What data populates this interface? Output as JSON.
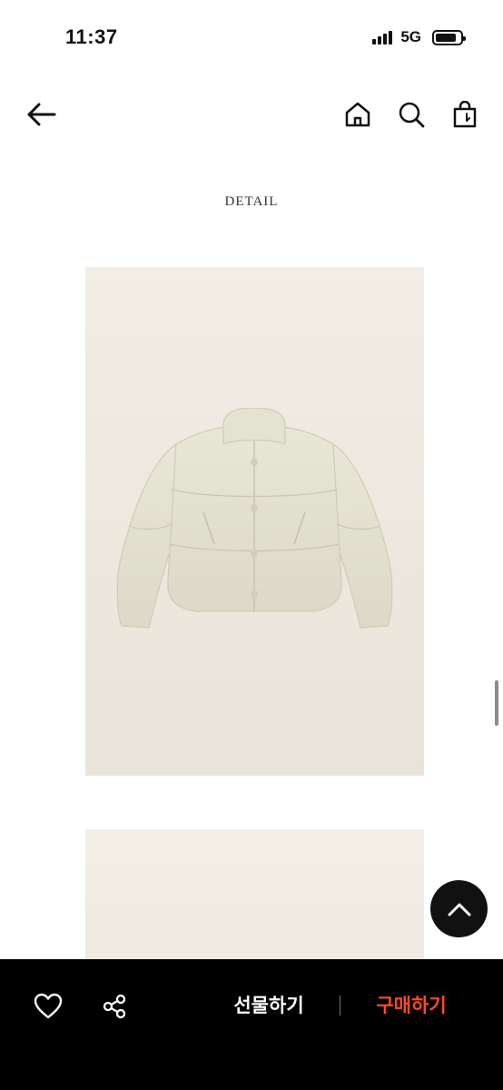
{
  "status_bar": {
    "time": "11:37",
    "network": "5G",
    "battery_level": 0.85,
    "signal_bars": 4
  },
  "nav": {
    "icons": [
      "back-arrow-icon",
      "home-icon",
      "search-icon",
      "shopping-bag-icon"
    ]
  },
  "content": {
    "section_title": "DETAIL",
    "images": [
      "product-photo-cream-puffer-jacket",
      "product-photo-2"
    ]
  },
  "bottom_bar": {
    "gift_label": "선물하기",
    "buy_label": "구매하기",
    "icons": [
      "heart-icon",
      "share-icon"
    ]
  },
  "colors": {
    "accent_buy": "#ff4a1c",
    "bar_background": "#000000",
    "image_background": "#efe9e1"
  }
}
